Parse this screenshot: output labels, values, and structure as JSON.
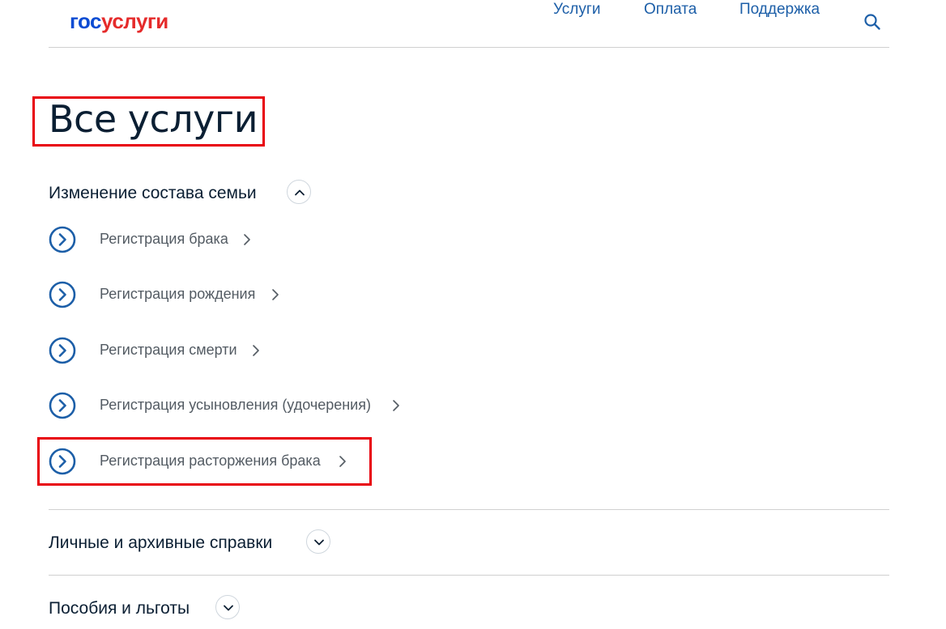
{
  "header": {
    "logo_part1": "гос",
    "logo_part2": "услуги",
    "nav": {
      "services": "Услуги",
      "payment": "Оплата",
      "support": "Поддержка"
    },
    "search_icon": "search-icon"
  },
  "page": {
    "title": "Все услуги"
  },
  "categories": [
    {
      "label": "Изменение состава семьи",
      "state": "expanded",
      "items": [
        {
          "label": "Регистрация брака"
        },
        {
          "label": "Регистрация рождения"
        },
        {
          "label": "Регистрация смерти"
        },
        {
          "label": "Регистрация усыновления (удочерения)"
        },
        {
          "label": "Регистрация расторжения брака"
        }
      ]
    },
    {
      "label": "Личные и архивные справки",
      "state": "collapsed"
    },
    {
      "label": "Пособия и льготы",
      "state": "collapsed"
    }
  ],
  "colors": {
    "brand_blue": "#0d4cd3",
    "brand_red": "#e52b2b",
    "link": "#1d5fa8",
    "icon_circle": "#1d5fa8",
    "highlight": "#e8000b"
  }
}
